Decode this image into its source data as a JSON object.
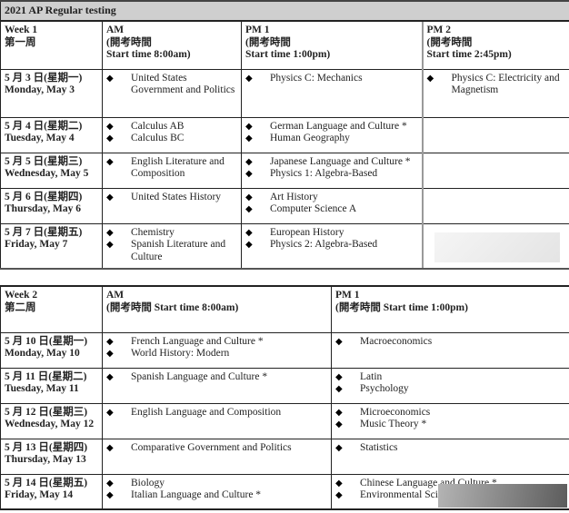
{
  "title": "2021 AP Regular testing",
  "bullet_icon": "◆",
  "week1": {
    "header": {
      "week": [
        "Week 1",
        "第一周"
      ],
      "am": [
        "AM",
        "(開考時間",
        "Start time 8:00am)"
      ],
      "pm1": [
        "PM 1",
        "(開考時間",
        "Start time 1:00pm)"
      ],
      "pm2": [
        "PM 2",
        "(開考時間",
        "Start time 2:45pm)"
      ]
    },
    "rows": [
      {
        "date_cn": "5 月 3 日(星期一)",
        "date_en": "Monday, May 3",
        "am": [
          "United States Government and Politics"
        ],
        "pm1": [
          "Physics C: Mechanics"
        ],
        "pm2": [
          "Physics C: Electricity and Magnetism"
        ]
      },
      {
        "date_cn": "5 月 4 日(星期二)",
        "date_en": "Tuesday, May 4",
        "am": [
          "Calculus AB",
          "Calculus BC"
        ],
        "pm1": [
          "German Language and Culture *",
          "Human Geography"
        ],
        "pm2": []
      },
      {
        "date_cn": "5 月 5 日(星期三)",
        "date_en": "Wednesday, May 5",
        "am": [
          "English Literature and Composition"
        ],
        "pm1": [
          "Japanese Language and Culture *",
          "Physics 1: Algebra-Based"
        ],
        "pm2": []
      },
      {
        "date_cn": "5 月 6 日(星期四)",
        "date_en": "Thursday, May 6",
        "am": [
          "United States History"
        ],
        "pm1": [
          "Art History",
          "Computer Science A"
        ],
        "pm2": []
      },
      {
        "date_cn": "5 月 7 日(星期五)",
        "date_en": "Friday, May 7",
        "am": [
          "Chemistry",
          "Spanish Literature and Culture"
        ],
        "pm1": [
          "European History",
          "Physics 2: Algebra-Based"
        ],
        "pm2": []
      }
    ]
  },
  "week2": {
    "header": {
      "week": [
        "Week 2",
        "第二周"
      ],
      "am": [
        "AM",
        "(開考時間 Start time 8:00am)"
      ],
      "pm1": [
        "PM 1",
        "(開考時間 Start time 1:00pm)"
      ]
    },
    "rows": [
      {
        "date_cn": "5 月 10 日(星期一)",
        "date_en": "Monday, May 10",
        "am": [
          "French Language and Culture *",
          "World History: Modern"
        ],
        "pm1": [
          "Macroeconomics"
        ]
      },
      {
        "date_cn": "5 月 11 日(星期二)",
        "date_en": "Tuesday, May 11",
        "am": [
          "Spanish Language and Culture *"
        ],
        "pm1": [
          "Latin",
          "Psychology"
        ]
      },
      {
        "date_cn": "5 月 12 日(星期三)",
        "date_en": "Wednesday, May 12",
        "am": [
          "English Language and Composition"
        ],
        "pm1": [
          "Microeconomics",
          "Music Theory *"
        ]
      },
      {
        "date_cn": "5 月 13 日(星期四)",
        "date_en": "Thursday, May 13",
        "am": [
          "Comparative Government and Politics"
        ],
        "pm1": [
          "Statistics"
        ]
      },
      {
        "date_cn": "5 月 14 日(星期五)",
        "date_en": "Friday, May 14",
        "am": [
          "Biology",
          "Italian Language and Culture *"
        ],
        "pm1": [
          "Chinese Language and Culture *",
          "Environmental Science"
        ]
      }
    ]
  }
}
